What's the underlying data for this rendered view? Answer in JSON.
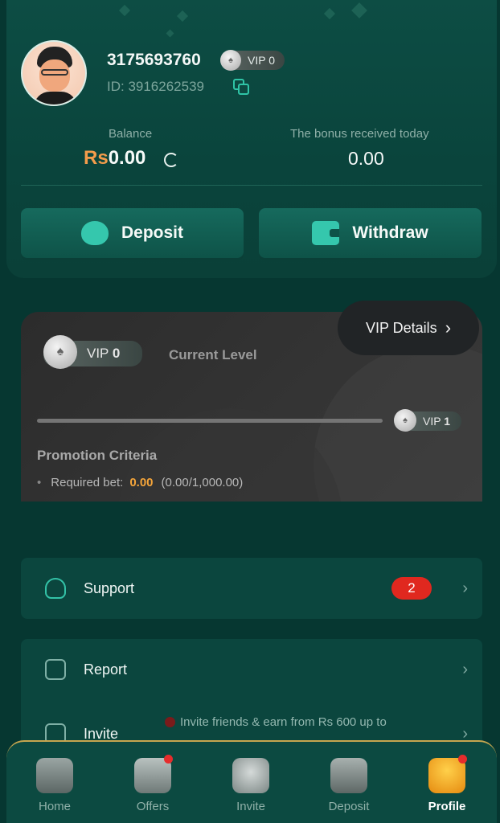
{
  "profile": {
    "username": "3175693760",
    "vip_badge": "VIP 0",
    "user_id": "ID: 3916262539"
  },
  "balance": {
    "label": "Balance",
    "currency": "Rs",
    "amount": "0.00",
    "bonus_label": "The bonus received today",
    "bonus_amount": "0.00"
  },
  "actions": {
    "deposit_label": "Deposit",
    "withdraw_label": "Withdraw"
  },
  "vip": {
    "details_label": "VIP Details",
    "current_vip_prefix": "VIP",
    "current_vip_number": "0",
    "current_level_label": "Current Level",
    "next_vip_prefix": "VIP",
    "next_vip_number": "1",
    "progress": 0,
    "promotion_title": "Promotion Criteria",
    "required_bet_label": "Required bet:",
    "required_bet_value": "0.00",
    "required_bet_progress": "(0.00/1,000.00)"
  },
  "menu": {
    "support_label": "Support",
    "support_badge": "2",
    "report_label": "Report",
    "invite_label": "Invite",
    "invite_note": "Invite friends & earn from Rs 600 up to"
  },
  "tabbar": {
    "home": "Home",
    "offers": "Offers",
    "invite": "Invite",
    "deposit": "Deposit",
    "profile": "Profile"
  },
  "colors": {
    "background": "#063731",
    "accent": "#35c7ad",
    "currency": "#f39c4b",
    "badge": "#e0281f",
    "highlight": "#f5a53a"
  },
  "icons": {
    "copy": "copy-icon",
    "refresh": "refresh-icon",
    "deposit": "piggy-bank-icon",
    "withdraw": "wallet-icon",
    "support": "headset-icon",
    "report": "report-icon",
    "invite": "gift-icon"
  }
}
